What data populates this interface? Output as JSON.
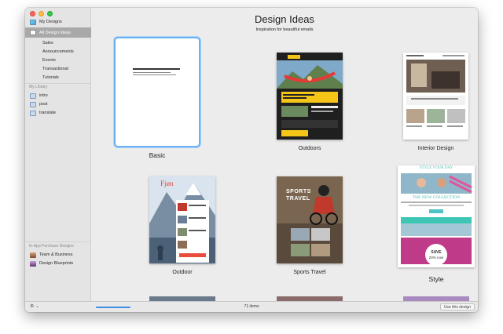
{
  "header": {
    "title": "Design Ideas",
    "subtitle": "Inspiration for beautiful emails"
  },
  "sidebar": {
    "my_designs": "My Designs",
    "all_design_ideas": "All Design Ideas",
    "categories": [
      "Sales",
      "Announcements",
      "Events",
      "Transactional",
      "Tutorials"
    ],
    "library_heading": "My Library",
    "library_items": [
      "intro",
      "post",
      "translate"
    ],
    "purchase_heading": "In-App Purchase Designs",
    "purchase_items": [
      "Team & Business",
      "Design Blueprints"
    ]
  },
  "gallery": {
    "items": [
      {
        "caption": "Basic"
      },
      {
        "caption": "Outdoors"
      },
      {
        "caption": "Interior Design"
      },
      {
        "caption": "Outdoor"
      },
      {
        "caption": "Sports Travel"
      },
      {
        "caption": "Style"
      }
    ]
  },
  "thumb_text": {
    "fjon": "Fjøn",
    "sports1": "SPORTS",
    "sports2": "TRAVEL",
    "style_day": "STYLE YOUR DAY",
    "new_collection": "THE NEW COLLECTION",
    "save": "SAVE",
    "percent": "20% now"
  },
  "footer": {
    "count": "71 items",
    "use_button": "Use this design",
    "gear_label": "⚙ ⌄",
    "progress": 1.0
  },
  "colors": {
    "accent": "#3f8ee8",
    "selection_border": "#6ab2f2",
    "sidebar_selected": "#a9a9a9"
  }
}
